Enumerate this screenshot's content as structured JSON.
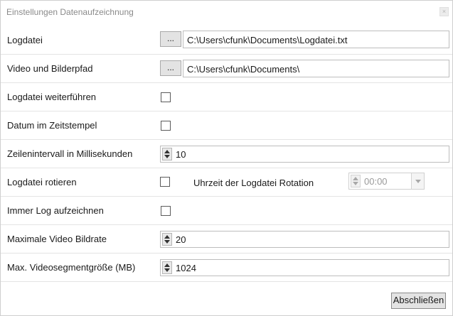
{
  "window": {
    "title": "Einstellungen Datenaufzeichnung",
    "close_glyph": "×"
  },
  "rows": {
    "logfile": {
      "label": "Logdatei",
      "browse_label": "...",
      "path": "C:\\Users\\cfunk\\Documents\\Logdatei.txt"
    },
    "media_path": {
      "label": "Video und Bilderpfad",
      "browse_label": "...",
      "path": "C:\\Users\\cfunk\\Documents\\"
    },
    "continue_log": {
      "label": "Logdatei weiterführen",
      "checked": false
    },
    "date_in_timestamp": {
      "label": "Datum im Zeitstempel",
      "checked": false
    },
    "line_interval": {
      "label": "Zeilenintervall in Millisekunden",
      "value": "10"
    },
    "rotate_log": {
      "label": "Logdatei rotieren",
      "checked": false,
      "rotation_time_label": "Uhrzeit der Logdatei Rotation",
      "rotation_time_value": "00:00"
    },
    "always_log": {
      "label": "Immer Log aufzeichnen",
      "checked": false
    },
    "max_framerate": {
      "label": "Maximale Video Bildrate",
      "value": "20"
    },
    "max_segment": {
      "label": "Max. Videosegmentgröße (MB)",
      "value": "1024"
    }
  },
  "footer": {
    "finish_label": "Abschließen"
  }
}
